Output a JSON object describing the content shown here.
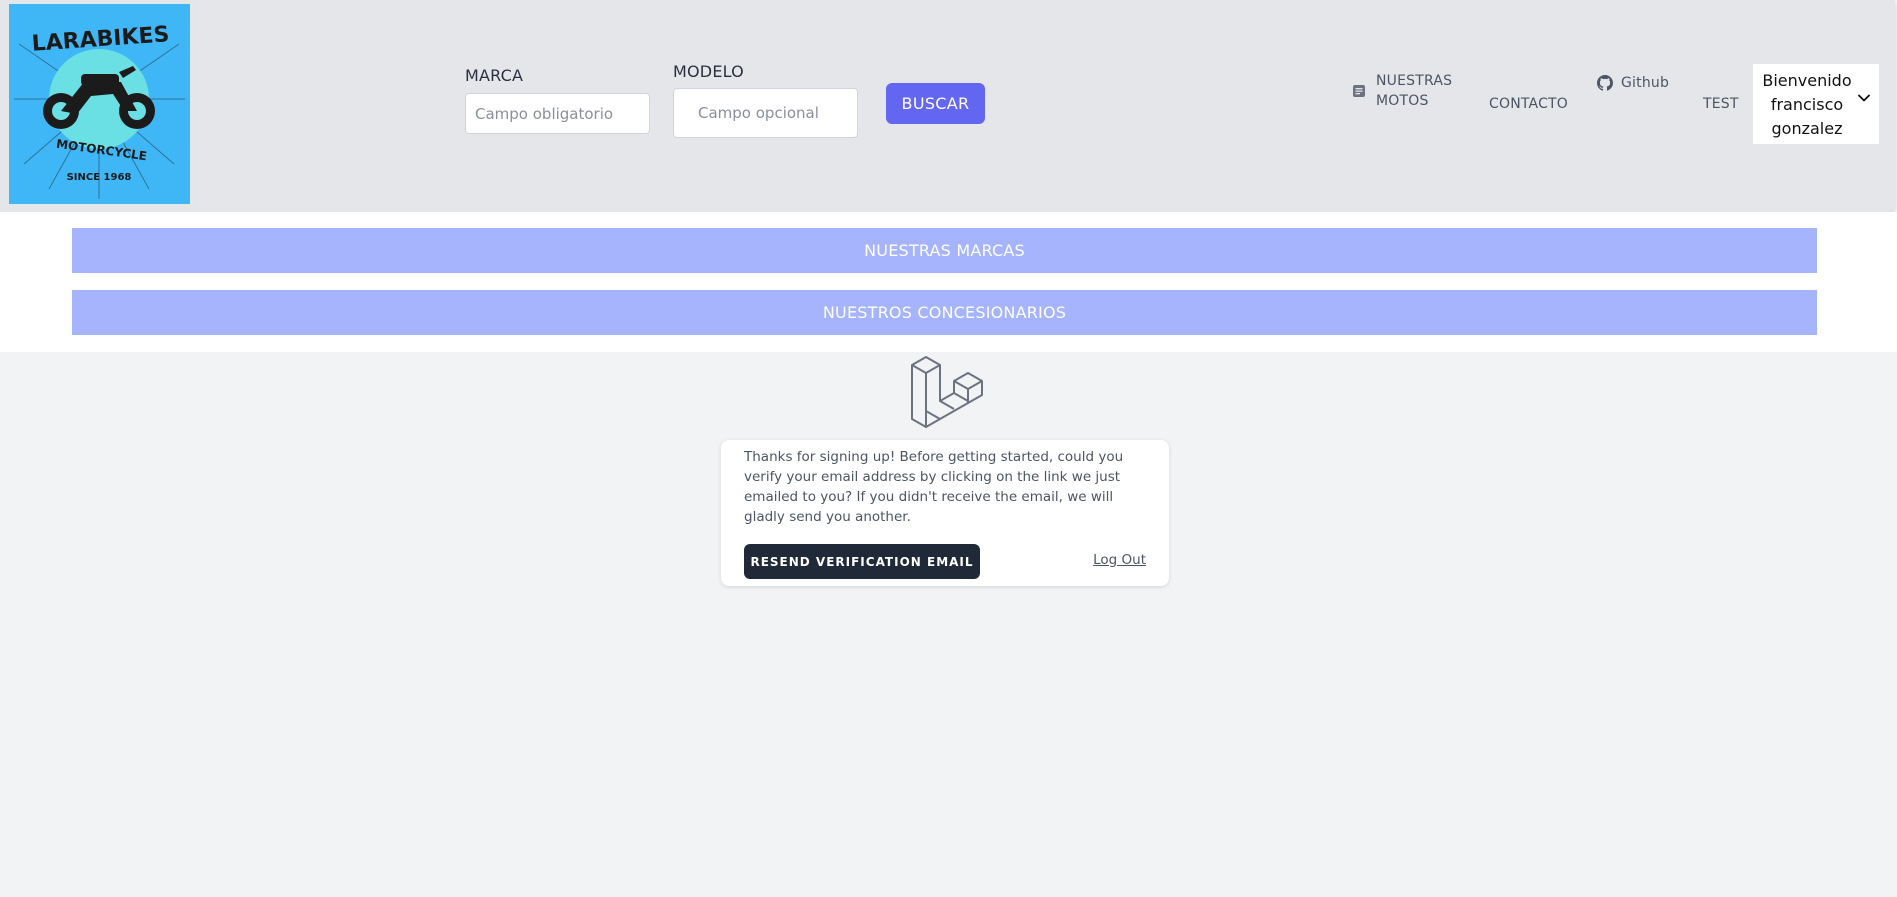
{
  "logo": {
    "brand": "LARABIKES",
    "tagline": "MOTORCYCLE",
    "since": "SINCE 1968"
  },
  "search": {
    "marca_label": "MARCA",
    "marca_placeholder": "Campo obligatorio",
    "modelo_label": "MODELO",
    "modelo_placeholder": "Campo opcional",
    "button_label": "BUSCAR"
  },
  "nav": {
    "motos_line1": "NUESTRAS",
    "motos_line2": "MOTOS",
    "contacto": "CONTACTO",
    "github": "Github",
    "test": "TEST",
    "user_line1": "Bienvenido",
    "user_line2": "francisco",
    "user_line3": "gonzalez"
  },
  "sections": {
    "marcas": "NUESTRAS MARCAS",
    "concesionarios": "NUESTROS CONCESIONARIOS"
  },
  "verify": {
    "message": "Thanks for signing up! Before getting started, could you verify your email address by clicking on the link we just emailed to you? If you didn't receive the email, we will gladly send you another.",
    "resend_label": "RESEND VERIFICATION EMAIL",
    "logout_label": "Log Out"
  },
  "colors": {
    "header_bg": "#e5e6ea",
    "accent": "#6366f1",
    "section_bar": "#a5b4fc",
    "logo_bg": "#3fb7f6",
    "dark_button": "#1f2937"
  },
  "icons": {
    "motos": "document-icon",
    "github": "github-icon",
    "user_menu": "chevron-down-icon",
    "app": "laravel-logo-icon"
  }
}
